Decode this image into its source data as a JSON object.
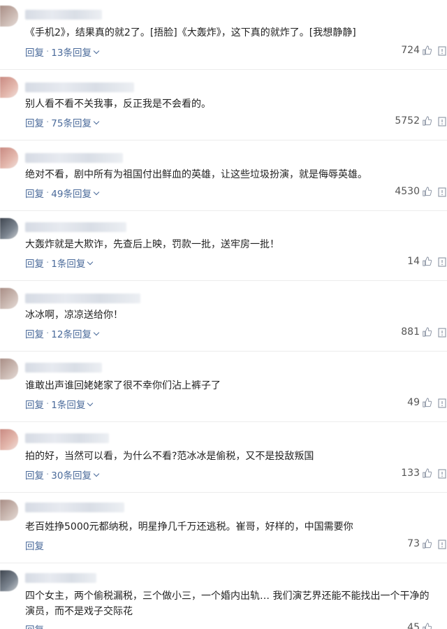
{
  "labels": {
    "reply": "回复"
  },
  "comments": [
    {
      "text": "《手机2》，结果真的就2了。[捂脸]《大轰炸》，这下真的就炸了。[我想静静]",
      "replies": "13条回复",
      "likes": "724"
    },
    {
      "text": "别人看不看不关我事，反正我是不会看的。",
      "replies": "75条回复",
      "likes": "5752"
    },
    {
      "text": "绝对不看，剧中所有为祖国付出鲜血的英雄，让这些垃圾扮演，就是侮辱英雄。",
      "replies": "49条回复",
      "likes": "4530"
    },
    {
      "text": "大轰炸就是大欺诈，先查后上映，罚款一批，送牢房一批！",
      "replies": "1条回复",
      "likes": "14"
    },
    {
      "text": "冰冰啊，凉凉送给你！",
      "replies": "12条回复",
      "likes": "881"
    },
    {
      "text": "谁敢出声谁回姥姥家了很不幸你们沾上裤子了",
      "replies": "1条回复",
      "likes": "49"
    },
    {
      "text": "拍的好，当然可以看，为什么不看?范冰冰是偷税，又不是投敌叛国",
      "replies": "30条回复",
      "likes": "133"
    },
    {
      "text": "老百姓挣5000元都纳税，明星挣几千万还逃税。崔哥，好样的，中国需要你",
      "replies": "",
      "likes": "73"
    },
    {
      "text": "四个女主，两个偷税漏税，三个做小三，一个婚内出轨… 我们演艺界还能不能找出一个干净的演员，而不是戏子交际花",
      "replies": "",
      "likes": "45"
    }
  ]
}
